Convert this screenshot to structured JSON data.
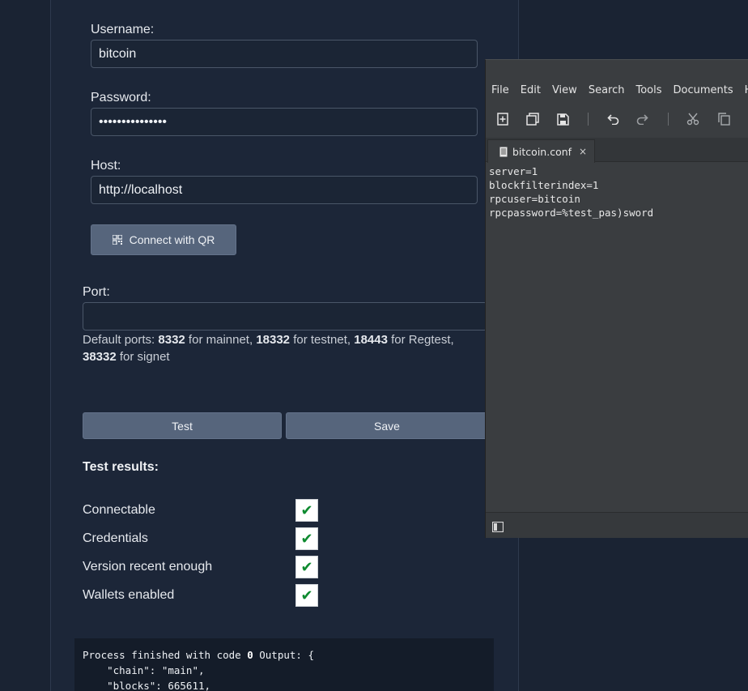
{
  "form": {
    "username_label": "Username:",
    "username_value": "bitcoin",
    "password_label": "Password:",
    "password_value": "•••••••••••••••",
    "host_label": "Host:",
    "host_value": "http://localhost",
    "connect_qr_label": "Connect with QR",
    "port_label": "Port:",
    "port_value": "",
    "help": {
      "prefix": "Default ports: ",
      "mainnet_port": "8332",
      "mainnet_text": " for mainnet, ",
      "testnet_port": "18332",
      "testnet_text": " for testnet, ",
      "regtest_port": "18443",
      "regtest_text": " for Regtest, ",
      "signet_port": "38332",
      "signet_text": " for signet"
    },
    "test_button": "Test",
    "save_button": "Save"
  },
  "results": {
    "title": "Test results:",
    "items": [
      {
        "label": "Connectable",
        "status": "✔"
      },
      {
        "label": "Credentials",
        "status": "✔"
      },
      {
        "label": "Version recent enough",
        "status": "✔"
      },
      {
        "label": "Wallets enabled",
        "status": "✔"
      }
    ]
  },
  "console": {
    "prefix": "Process finished with code ",
    "code": "0",
    "suffix": " Output: {",
    "line2": "    \"chain\": \"main\",",
    "line3": "    \"blocks\": 665611,"
  },
  "editor": {
    "menu": [
      "File",
      "Edit",
      "View",
      "Search",
      "Tools",
      "Documents",
      "Help"
    ],
    "toolbar_icons": [
      "new-document-icon",
      "open-icon",
      "save-icon",
      "undo-icon",
      "redo-icon",
      "cut-icon",
      "copy-icon"
    ],
    "tab_title": "bitcoin.conf",
    "tab_close": "×",
    "content_lines": [
      "server=1",
      "blockfilterindex=1",
      "rpcuser=bitcoin",
      "rpcpassword=%test_pas)sword"
    ]
  },
  "colors": {
    "page_bg": "#1a2333",
    "button_bg": "#56657c",
    "check_green": "#0e8a2f",
    "editor_bg": "#3a3d40"
  }
}
